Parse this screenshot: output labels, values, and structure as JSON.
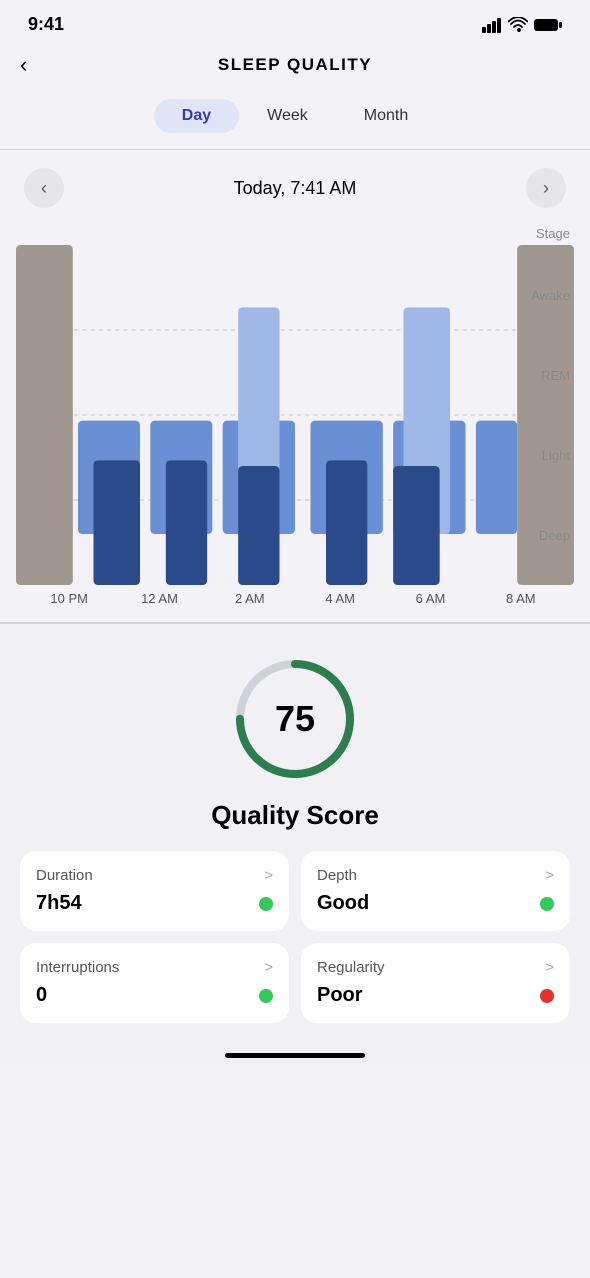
{
  "statusBar": {
    "time": "9:41",
    "signal": "signal-icon",
    "wifi": "wifi-icon",
    "battery": "battery-icon"
  },
  "header": {
    "back_label": "<",
    "title": "SLEEP QUALITY"
  },
  "tabs": {
    "items": [
      {
        "label": "Day",
        "active": true
      },
      {
        "label": "Week",
        "active": false
      },
      {
        "label": "Month",
        "active": false
      }
    ]
  },
  "dateNav": {
    "prev_label": "<",
    "date_label": "Today, 7:41 AM",
    "next_label": ">"
  },
  "chart": {
    "stage_label": "Stage",
    "y_labels": [
      "Awake",
      "REM",
      "Light",
      "Deep"
    ],
    "x_labels": [
      "10 PM",
      "12 AM",
      "2 AM",
      "4 AM",
      "6 AM",
      "8 AM"
    ]
  },
  "score": {
    "value": 75,
    "max": 100,
    "label": "Quality Score",
    "arc_color": "#2e7d4f",
    "track_color": "#d0d0d8"
  },
  "metrics": [
    {
      "name": "Duration",
      "value": "7h54",
      "dot_color": "green",
      "chevron": ">"
    },
    {
      "name": "Depth",
      "value": "Good",
      "dot_color": "green",
      "chevron": ">"
    },
    {
      "name": "Interruptions",
      "value": "0",
      "dot_color": "green",
      "chevron": ">"
    },
    {
      "name": "Regularity",
      "value": "Poor",
      "dot_color": "red",
      "chevron": ">"
    }
  ]
}
